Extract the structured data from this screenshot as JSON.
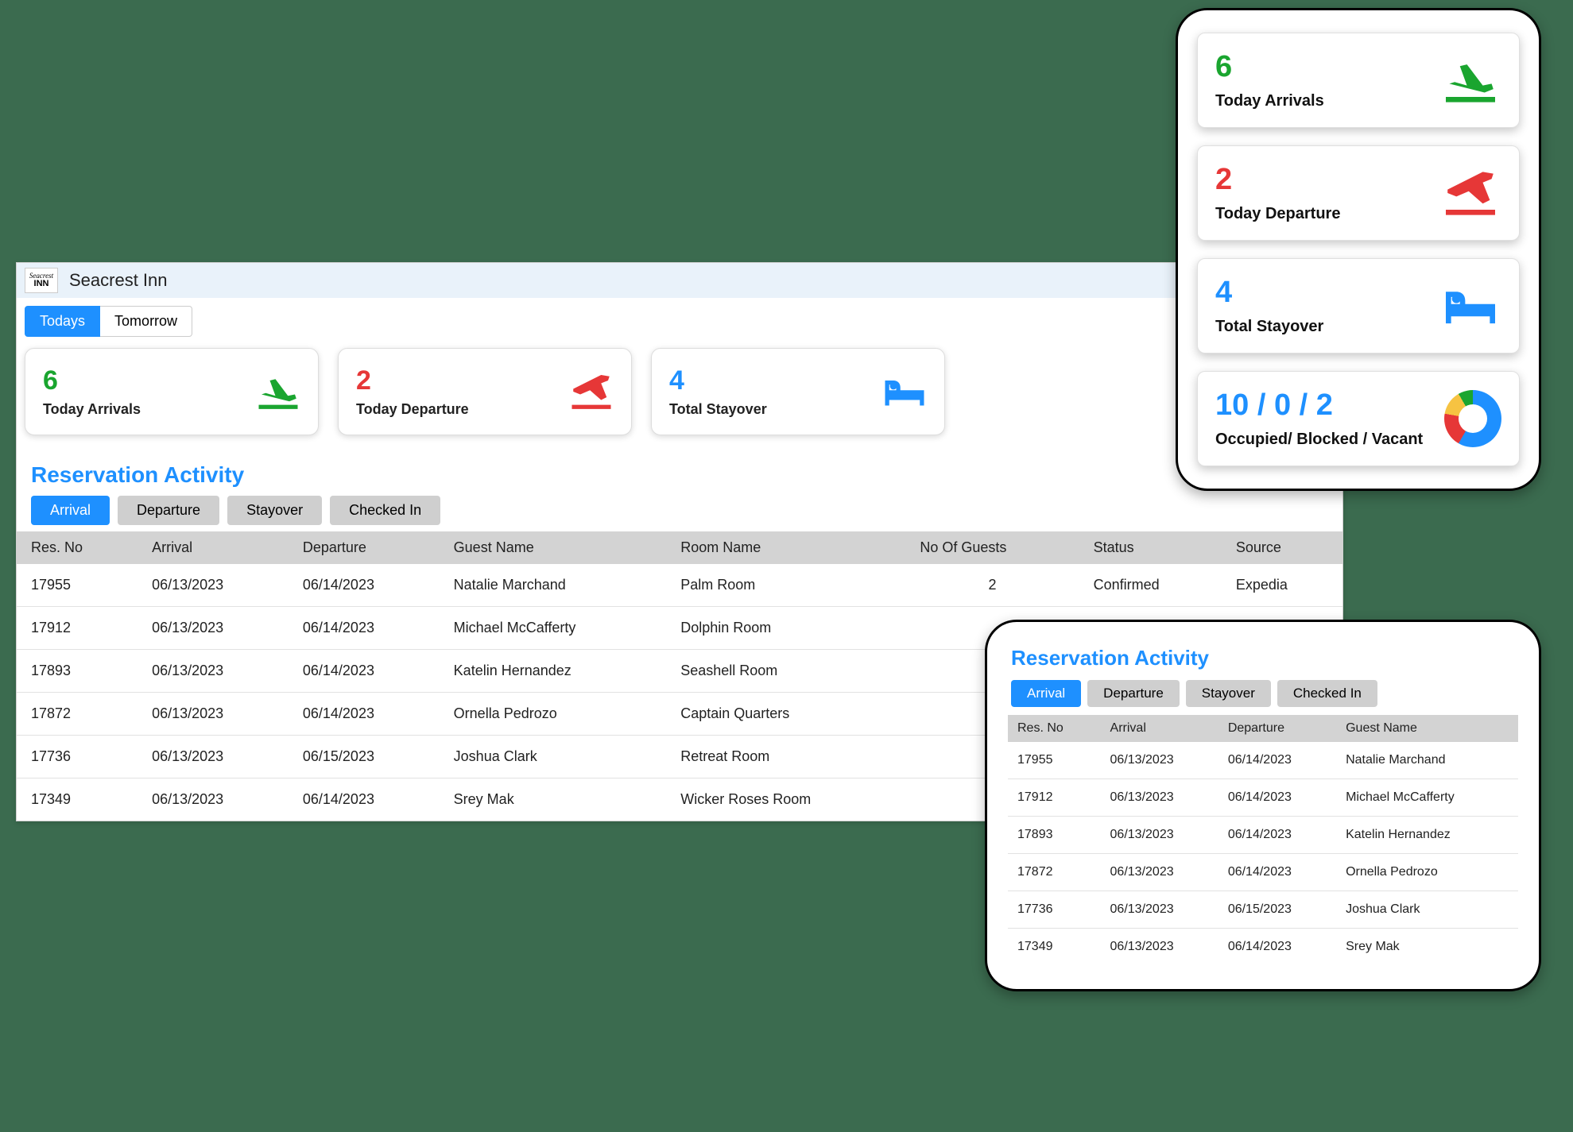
{
  "header": {
    "logo_top": "Seacrest",
    "logo_bottom": "INN",
    "title": "Seacrest Inn"
  },
  "day_tabs": {
    "active": "Todays",
    "items": [
      "Todays",
      "Tomorrow"
    ]
  },
  "stats": {
    "arrivals": {
      "value": "6",
      "label": "Today Arrivals"
    },
    "departures": {
      "value": "2",
      "label": "Today Departure"
    },
    "stayover": {
      "value": "4",
      "label": "Total Stayover"
    },
    "occupancy": {
      "value": "10 / 0 / 2",
      "label": "Occupied/ Blocked / Vacant"
    }
  },
  "reservation_activity": {
    "title": "Reservation Activity",
    "tabs": [
      "Arrival",
      "Departure",
      "Stayover",
      "Checked In"
    ],
    "active_tab": "Arrival",
    "columns": [
      "Res. No",
      "Arrival",
      "Departure",
      "Guest Name",
      "Room Name",
      "No Of Guests",
      "Status",
      "Source"
    ],
    "columns_short": [
      "Res. No",
      "Arrival",
      "Departure",
      "Guest Name"
    ],
    "rows": [
      {
        "res_no": "17955",
        "arrival": "06/13/2023",
        "departure": "06/14/2023",
        "guest": "Natalie Marchand",
        "room": "Palm Room",
        "guests": "2",
        "status": "Confirmed",
        "source": "Expedia"
      },
      {
        "res_no": "17912",
        "arrival": "06/13/2023",
        "departure": "06/14/2023",
        "guest": "Michael McCafferty",
        "room": "Dolphin Room",
        "guests": "",
        "status": "",
        "source": ""
      },
      {
        "res_no": "17893",
        "arrival": "06/13/2023",
        "departure": "06/14/2023",
        "guest": "Katelin Hernandez",
        "room": "Seashell Room",
        "guests": "",
        "status": "",
        "source": ""
      },
      {
        "res_no": "17872",
        "arrival": "06/13/2023",
        "departure": "06/14/2023",
        "guest": "Ornella Pedrozo",
        "room": "Captain Quarters",
        "guests": "",
        "status": "",
        "source": ""
      },
      {
        "res_no": "17736",
        "arrival": "06/13/2023",
        "departure": "06/15/2023",
        "guest": "Joshua Clark",
        "room": "Retreat Room",
        "guests": "",
        "status": "",
        "source": ""
      },
      {
        "res_no": "17349",
        "arrival": "06/13/2023",
        "departure": "06/14/2023",
        "guest": "Srey Mak",
        "room": "Wicker Roses Room",
        "guests": "",
        "status": "",
        "source": ""
      }
    ]
  }
}
